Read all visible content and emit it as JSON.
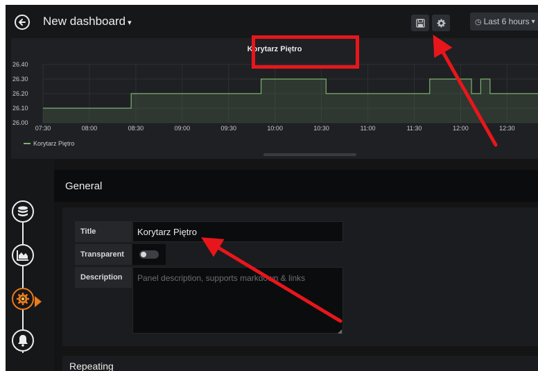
{
  "topbar": {
    "dashboard_title": "New dashboard",
    "dashboard_caret": "▾",
    "time_picker_label": "Last 6 hours",
    "time_picker_caret": "▾"
  },
  "panel": {
    "title": "Korytarz Piętro"
  },
  "chart_data": {
    "type": "line",
    "title": "Korytarz Piętro",
    "xlabel": "",
    "ylabel": "",
    "x_ticks": [
      "07:30",
      "08:00",
      "08:30",
      "09:00",
      "09:30",
      "10:00",
      "10:30",
      "11:00",
      "11:30",
      "12:00",
      "12:30"
    ],
    "y_ticks": [
      "26.00",
      "26.10",
      "26.20",
      "26.30",
      "26.40"
    ],
    "ylim": [
      26.0,
      26.4
    ],
    "xlim": [
      "07:30",
      "12:50"
    ],
    "series": [
      {
        "name": "Korytarz Piętro",
        "color": "#7eb26d",
        "fill": true,
        "x": [
          "07:30",
          "08:27",
          "08:27",
          "09:51",
          "09:51",
          "10:33",
          "10:33",
          "11:40",
          "11:40",
          "12:07",
          "12:07",
          "12:13",
          "12:13",
          "12:19",
          "12:19",
          "12:50"
        ],
        "y": [
          26.1,
          26.1,
          26.2,
          26.2,
          26.3,
          26.3,
          26.2,
          26.2,
          26.3,
          26.3,
          26.2,
          26.2,
          26.3,
          26.3,
          26.2,
          26.2
        ]
      }
    ],
    "legend_position": "bottom-left",
    "grid": true
  },
  "general": {
    "heading": "General",
    "title_label": "Title",
    "title_value": "Korytarz Piętro",
    "transparent_label": "Transparent",
    "transparent_on": false,
    "description_label": "Description",
    "description_placeholder": "Panel description, supports markdown & links"
  },
  "repeating": {
    "heading": "Repeating"
  },
  "annotation": {
    "color": "#e8161b"
  },
  "icons": {
    "back": "back-arrow-icon",
    "save": "save-icon",
    "settings": "gear-icon",
    "clock": "clock-icon",
    "queries": "database-icon",
    "visualization": "area-chart-icon",
    "general": "cog-icon",
    "alert": "bell-icon"
  }
}
